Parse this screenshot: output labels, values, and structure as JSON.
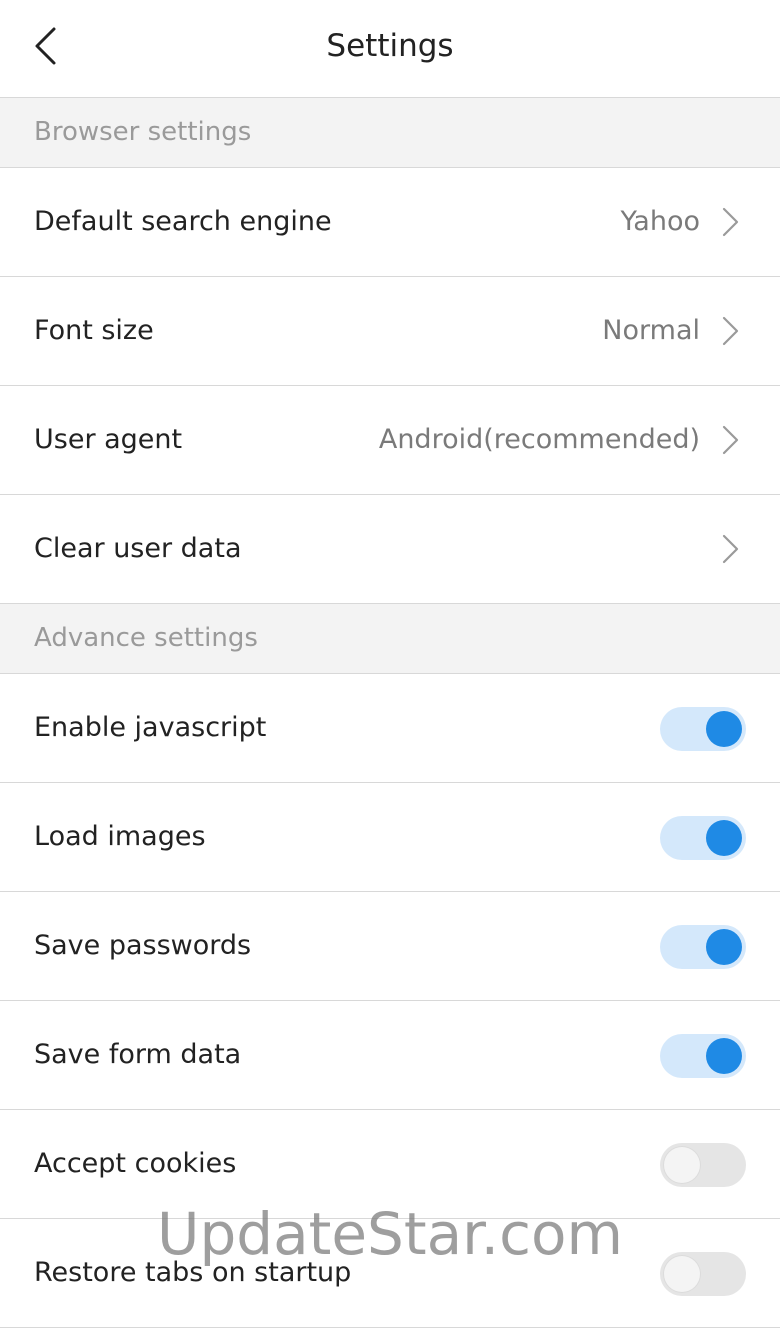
{
  "header": {
    "title": "Settings",
    "back_icon": "chevron-left-icon"
  },
  "sections": [
    {
      "title": "Browser settings",
      "rows": [
        {
          "label": "Default search engine",
          "value": "Yahoo"
        },
        {
          "label": "Font size",
          "value": "Normal"
        },
        {
          "label": "User agent",
          "value": "Android(recommended)"
        },
        {
          "label": "Clear user data",
          "value": ""
        }
      ]
    },
    {
      "title": "Advance settings",
      "rows": [
        {
          "label": "Enable javascript",
          "enabled": true
        },
        {
          "label": "Load images",
          "enabled": true
        },
        {
          "label": "Save passwords",
          "enabled": true
        },
        {
          "label": "Save form data",
          "enabled": true
        },
        {
          "label": "Accept cookies",
          "enabled": false
        },
        {
          "label": "Restore tabs on startup",
          "enabled": false
        }
      ]
    }
  ],
  "colors": {
    "accent": "#1f8ae5",
    "toggle_track_on": "#d4e8fb",
    "toggle_track_off": "#e5e5e5",
    "section_bg": "#f3f3f3",
    "divider": "#d8d8d8"
  },
  "watermark": "UpdateStar.com"
}
